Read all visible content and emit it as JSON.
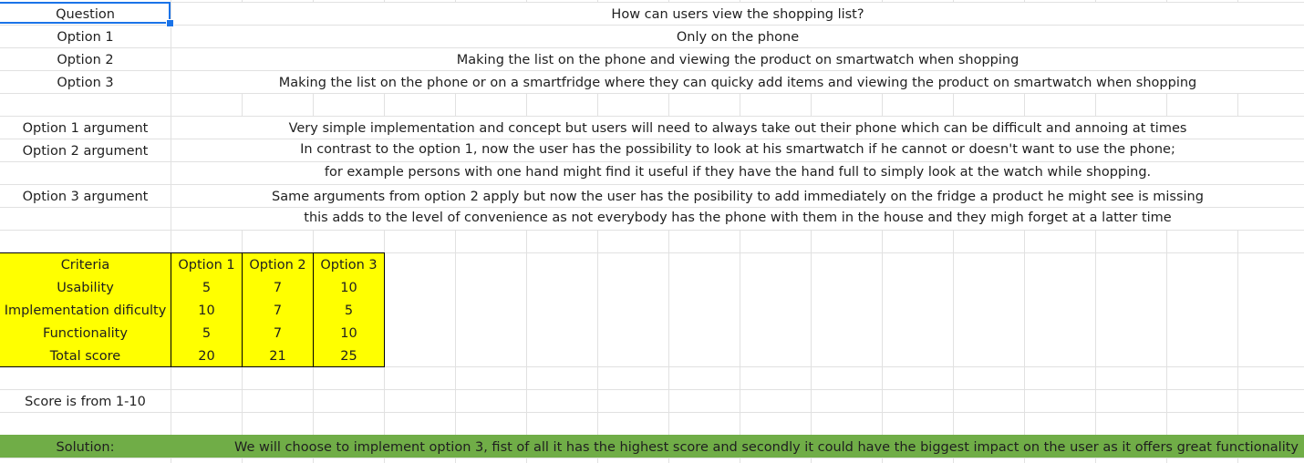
{
  "header_rows": {
    "question_label": "Question",
    "question_value": "How can users view the shopping list?",
    "option1_label": "Option 1",
    "option1_value": "Only on the phone",
    "option2_label": "Option 2",
    "option2_value": "Making the list on the phone and viewing the product on smartwatch when shopping",
    "option3_label": "Option 3",
    "option3_value": "Making the list on the phone or on a smartfridge where they can quicky add items and viewing the product on smartwatch when shopping"
  },
  "arguments": {
    "option1_label": "Option 1 argument",
    "option1_text": "Very simple implementation and concept but users will need to always take out their phone which can be difficult and annoing at times",
    "option2_label": "Option 2 argument",
    "option2_text_1": "In contrast to the option 1, now the user has the possibility to look at his smartwatch if he cannot or doesn't want to use the phone;",
    "option2_text_2": "for example persons with one hand might find it useful if they have the hand full to simply look at the watch while shopping.",
    "option3_label": "Option 3 argument",
    "option3_text_1": "Same arguments from option 2 apply but now the user has the posibility to add immediately on the fridge a product he might see is missing",
    "option3_text_2": "this adds to the level of convenience as not everybody has the phone with them in the house and they migh forget at a latter time"
  },
  "criteria_table": {
    "headers": [
      "Criteria",
      "Option 1",
      "Option 2",
      "Option 3"
    ],
    "rows": [
      [
        "Usability",
        "5",
        "7",
        "10"
      ],
      [
        "Implementation dificulty",
        "10",
        "7",
        "5"
      ],
      [
        "Functionality",
        "5",
        "7",
        "10"
      ],
      [
        "Total score",
        "20",
        "21",
        "25"
      ]
    ]
  },
  "score_note": "Score is from 1-10",
  "solution": {
    "label": "Solution:",
    "text": "We will choose to implement option 3, fist of all it has the highest score and secondly it could have the biggest impact on the user as it offers great functionality"
  },
  "colors": {
    "table_fill": "#ffff00",
    "solution_fill": "#70ad47",
    "selection": "#1a73e8"
  }
}
